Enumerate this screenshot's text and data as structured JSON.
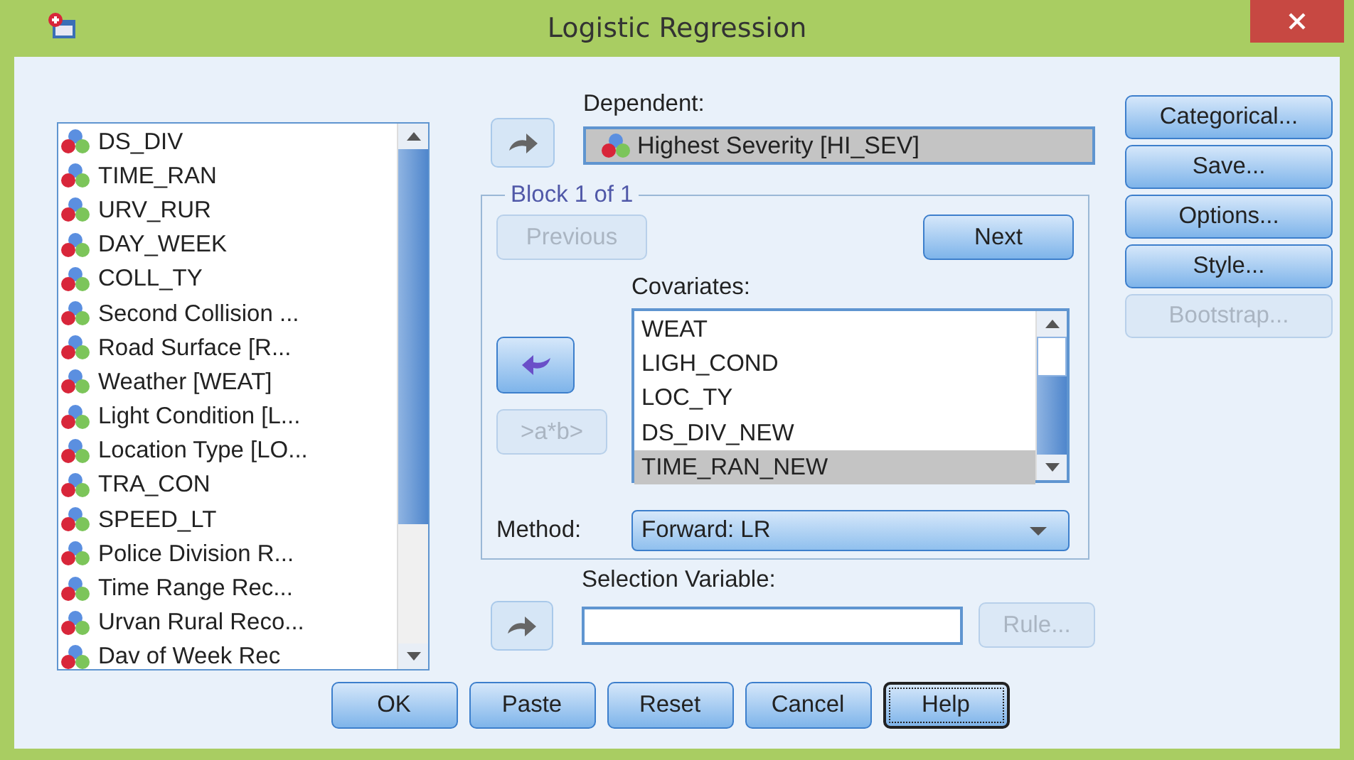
{
  "window": {
    "title": "Logistic Regression"
  },
  "variables": {
    "items": [
      {
        "label": "DS_DIV",
        "selected": false
      },
      {
        "label": "TIME_RAN",
        "selected": false
      },
      {
        "label": "URV_RUR",
        "selected": false
      },
      {
        "label": "DAY_WEEK",
        "selected": false
      },
      {
        "label": "COLL_TY",
        "selected": false
      },
      {
        "label": "Second Collision ...",
        "selected": false
      },
      {
        "label": "Road Surface [R...",
        "selected": false
      },
      {
        "label": "Weather [WEAT]",
        "selected": false
      },
      {
        "label": "Light Condition [L...",
        "selected": false
      },
      {
        "label": "Location Type [LO...",
        "selected": false
      },
      {
        "label": "TRA_CON",
        "selected": false
      },
      {
        "label": "SPEED_LT",
        "selected": false
      },
      {
        "label": "Police Division R...",
        "selected": false
      },
      {
        "label": "Time Range Rec...",
        "selected": false
      },
      {
        "label": "Urvan Rural Reco...",
        "selected": false
      },
      {
        "label": "Dav of Week Rec",
        "selected": false
      }
    ]
  },
  "dependent": {
    "label": "Dependent:",
    "value": "Highest Severity [HI_SEV]"
  },
  "block": {
    "title": "Block 1 of 1",
    "previous": {
      "label": "Previous",
      "disabled": true
    },
    "next": {
      "label": "Next",
      "disabled": false
    },
    "covariates": {
      "label": "Covariates:",
      "items": [
        {
          "label": "WEAT",
          "selected": false
        },
        {
          "label": "LIGH_COND",
          "selected": false
        },
        {
          "label": "LOC_TY",
          "selected": false
        },
        {
          "label": "DS_DIV_NEW",
          "selected": false
        },
        {
          "label": "TIME_RAN_NEW",
          "selected": true
        }
      ]
    },
    "interaction": {
      "label": ">a*b>",
      "disabled": true
    },
    "method": {
      "label": "Method:",
      "value": "Forward: LR"
    }
  },
  "selection_variable": {
    "label": "Selection Variable:",
    "rule": {
      "label": "Rule...",
      "disabled": true
    }
  },
  "side_buttons": [
    {
      "label": "Categorical...",
      "disabled": false
    },
    {
      "label": "Save...",
      "disabled": false
    },
    {
      "label": "Options...",
      "disabled": false
    },
    {
      "label": "Style...",
      "disabled": false
    },
    {
      "label": "Bootstrap...",
      "disabled": true
    }
  ],
  "buttons": [
    {
      "label": "OK",
      "focused": false
    },
    {
      "label": "Paste",
      "focused": false
    },
    {
      "label": "Reset",
      "focused": false
    },
    {
      "label": "Cancel",
      "focused": false
    },
    {
      "label": "Help",
      "focused": true
    }
  ]
}
